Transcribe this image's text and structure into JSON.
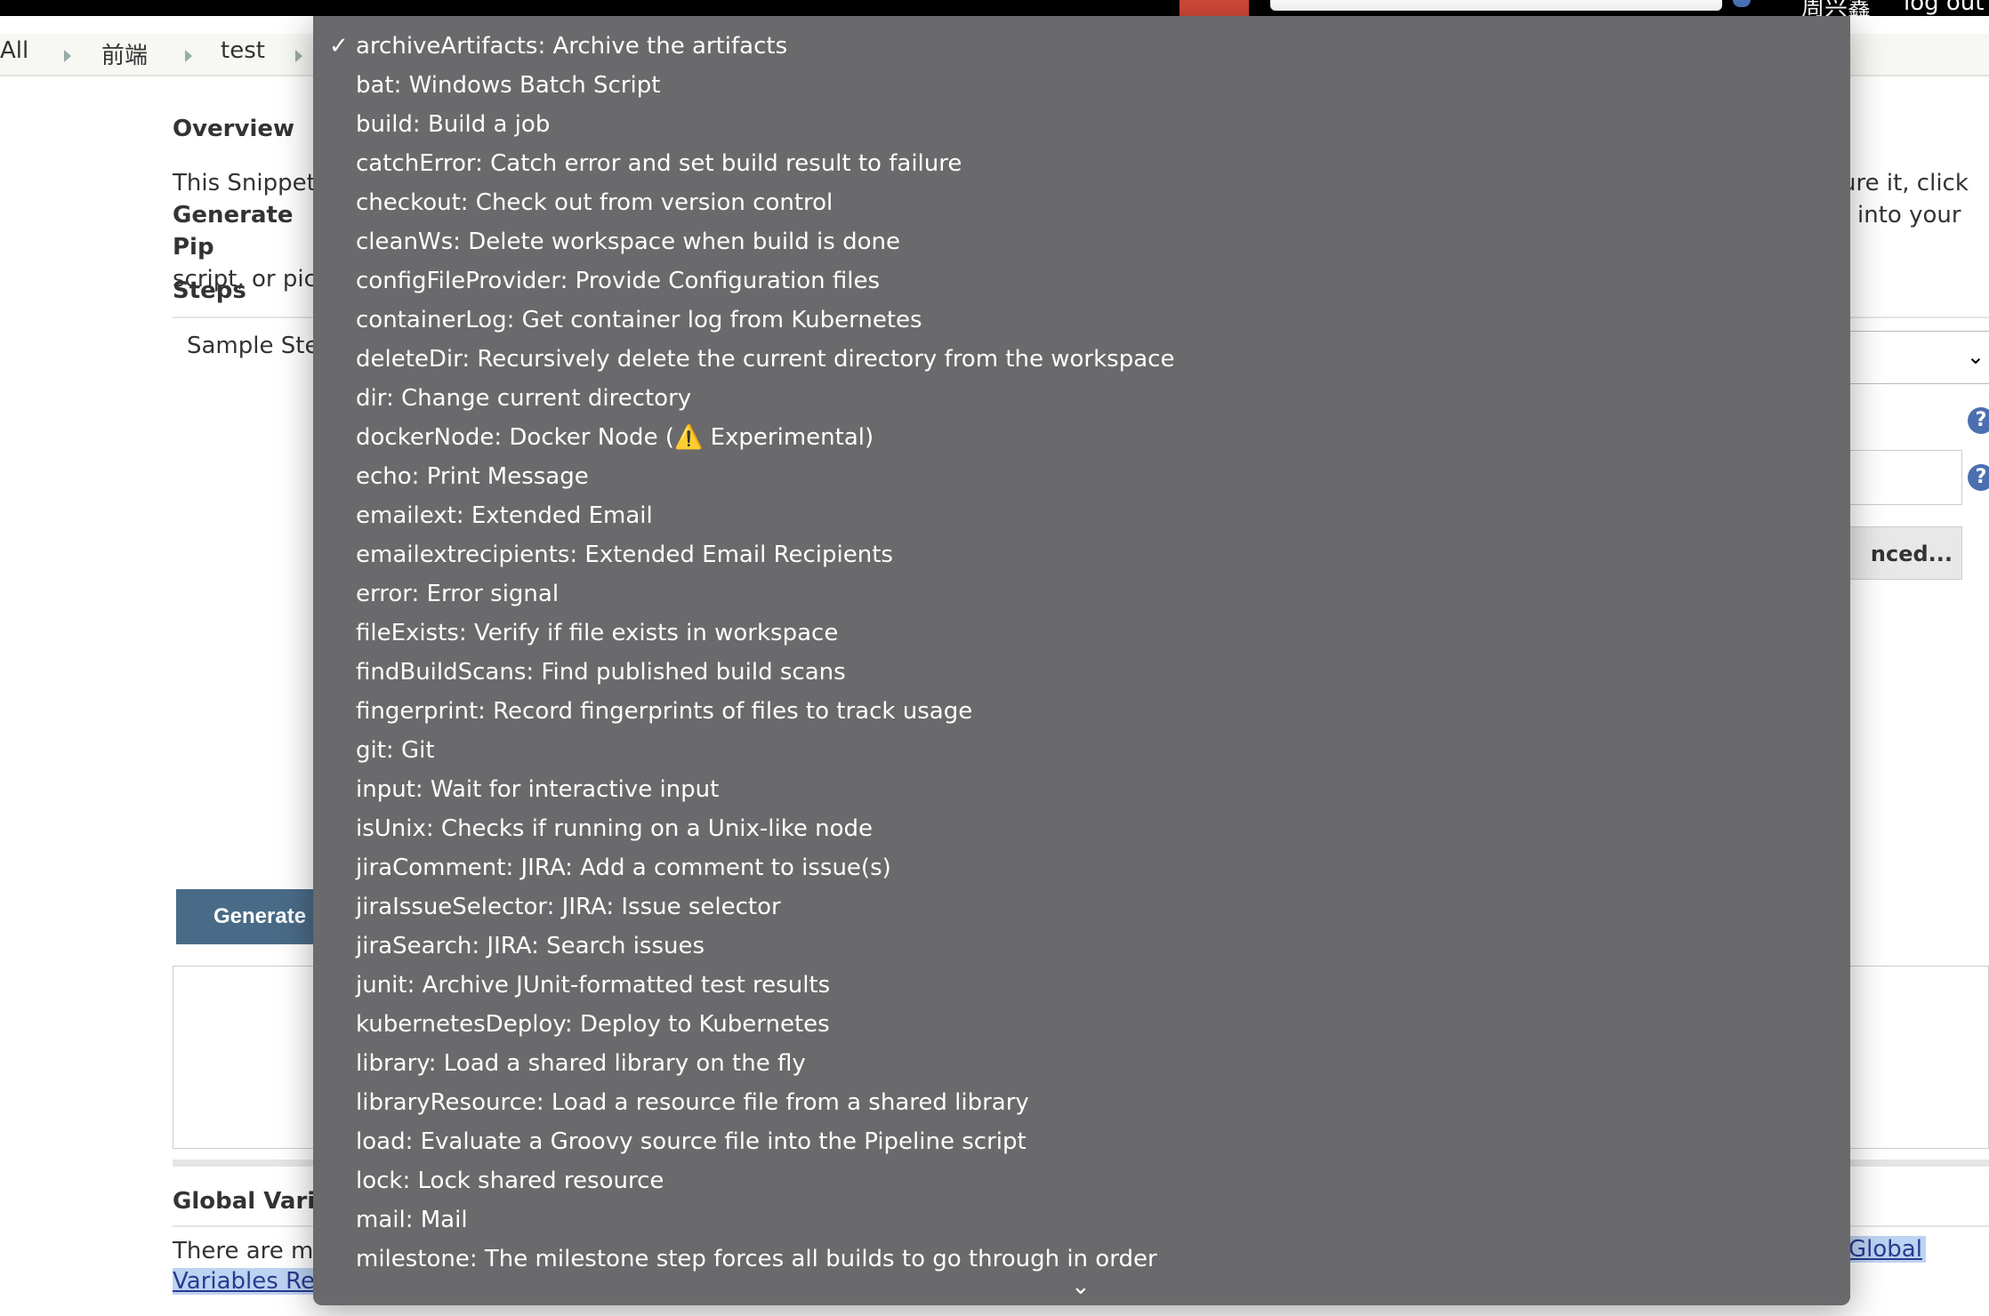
{
  "topbar": {
    "user": "周兴鑫",
    "logout": "log out"
  },
  "breadcrumb": [
    "All",
    "前端",
    "test"
  ],
  "overview": {
    "title": "Overview",
    "para_left": [
      "This Snippet",
      "Generate Pip",
      "script, or pick"
    ],
    "para_right": [
      "ure it, click",
      "into your"
    ]
  },
  "steps": {
    "title": "Steps",
    "sample_step": "Sample Step",
    "advanced": "nced...",
    "help": "?"
  },
  "generate": {
    "label": "Generate"
  },
  "global_vars": {
    "title": "Global Variab",
    "text": "There are ma",
    "link_left": "Variables Ref",
    "link_right": "Global"
  },
  "dropdown": {
    "selected_index": 0,
    "check": "✓",
    "more_icon": "⌄",
    "items": [
      "archiveArtifacts: Archive the artifacts",
      "bat: Windows Batch Script",
      "build: Build a job",
      "catchError: Catch error and set build result to failure",
      "checkout: Check out from version control",
      "cleanWs: Delete workspace when build is done",
      "configFileProvider: Provide Configuration files",
      "containerLog: Get container log from Kubernetes",
      "deleteDir: Recursively delete the current directory from the workspace",
      "dir: Change current directory",
      "dockerNode: Docker Node (⚠️ Experimental)",
      "echo: Print Message",
      "emailext: Extended Email",
      "emailextrecipients: Extended Email Recipients",
      "error: Error signal",
      "fileExists: Verify if file exists in workspace",
      "findBuildScans: Find published build scans",
      "fingerprint: Record fingerprints of files to track usage",
      "git: Git",
      "input: Wait for interactive input",
      "isUnix: Checks if running on a Unix-like node",
      "jiraComment: JIRA: Add a comment to issue(s)",
      "jiraIssueSelector: JIRA: Issue selector",
      "jiraSearch: JIRA: Search issues",
      "junit: Archive JUnit-formatted test results",
      "kubernetesDeploy: Deploy to Kubernetes",
      "library: Load a shared library on the fly",
      "libraryResource: Load a resource file from a shared library",
      "load: Evaluate a Groovy source file into the Pipeline script",
      "lock: Lock shared resource",
      "mail: Mail",
      "milestone: The milestone step forces all builds to go through in order"
    ]
  }
}
